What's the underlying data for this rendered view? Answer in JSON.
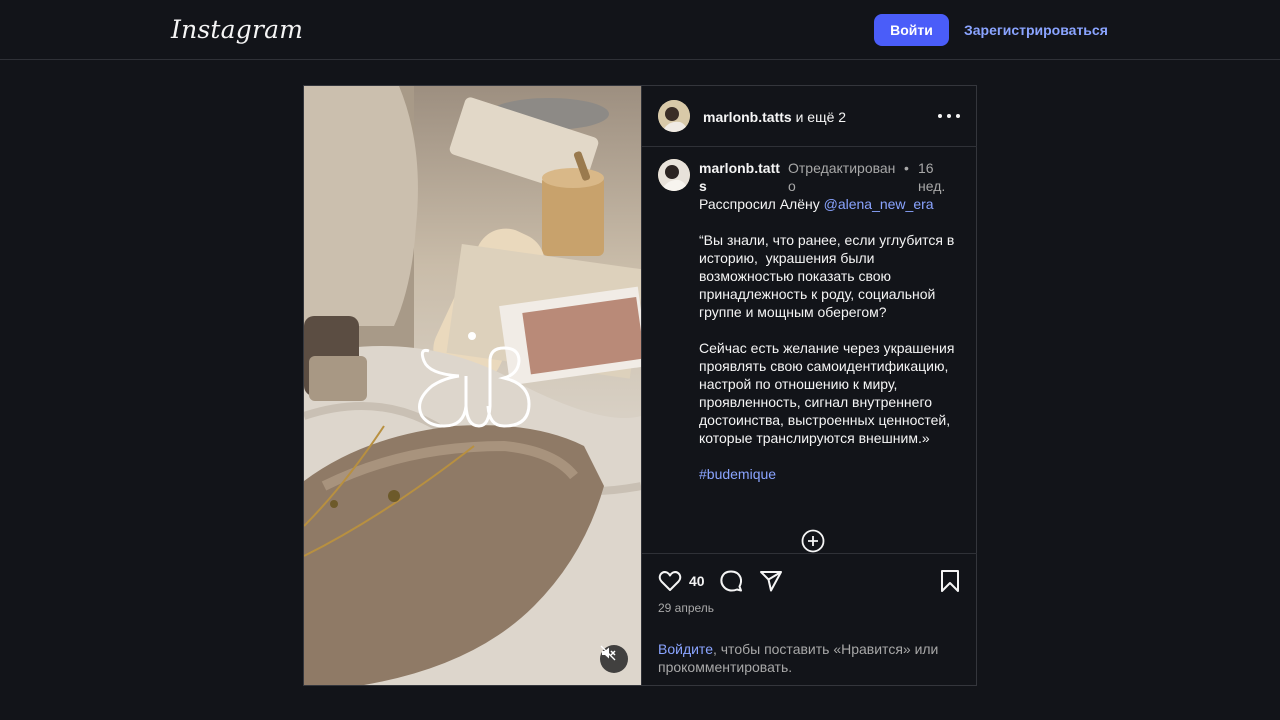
{
  "header": {
    "logo": "Instagram",
    "login_button": "Войти",
    "signup_link": "Зарегистрироваться"
  },
  "post": {
    "author_header": {
      "username": "marlonb.tatts",
      "suffix": " и ещё 2"
    },
    "caption": {
      "username": "marlonb.tatts",
      "edited": "Отредактировано",
      "separator": "•",
      "time": "16 нед.",
      "line1_prefix": "Расспросил Алёну ",
      "mention": "@alena_new_era",
      "paragraph1": "“Вы знали, что ранее, если углубится в историю,  украшения были возможностью показать свою принадлежность к роду, социальной группе и мощным оберегом?",
      "paragraph2": "Сейчас есть желание через украшения проявлять свою самоидентификацию, настрой по отношению к миру, проявленность, сигнал внутреннего достоинства, выстроенных ценностей, которые транслируются внешним.»",
      "hashtag": "#budemique"
    },
    "likes": "40",
    "date": "29 апрель",
    "login_prompt_link": "Войдите",
    "login_prompt_text": ", чтобы поставить «Нравится» или прокомментировать."
  },
  "icons": {
    "more": "more-options-icon",
    "plus": "plus-circle-icon",
    "like": "heart-icon",
    "comment": "comment-icon",
    "share": "send-icon",
    "save": "bookmark-icon",
    "mute": "mute-icon"
  }
}
